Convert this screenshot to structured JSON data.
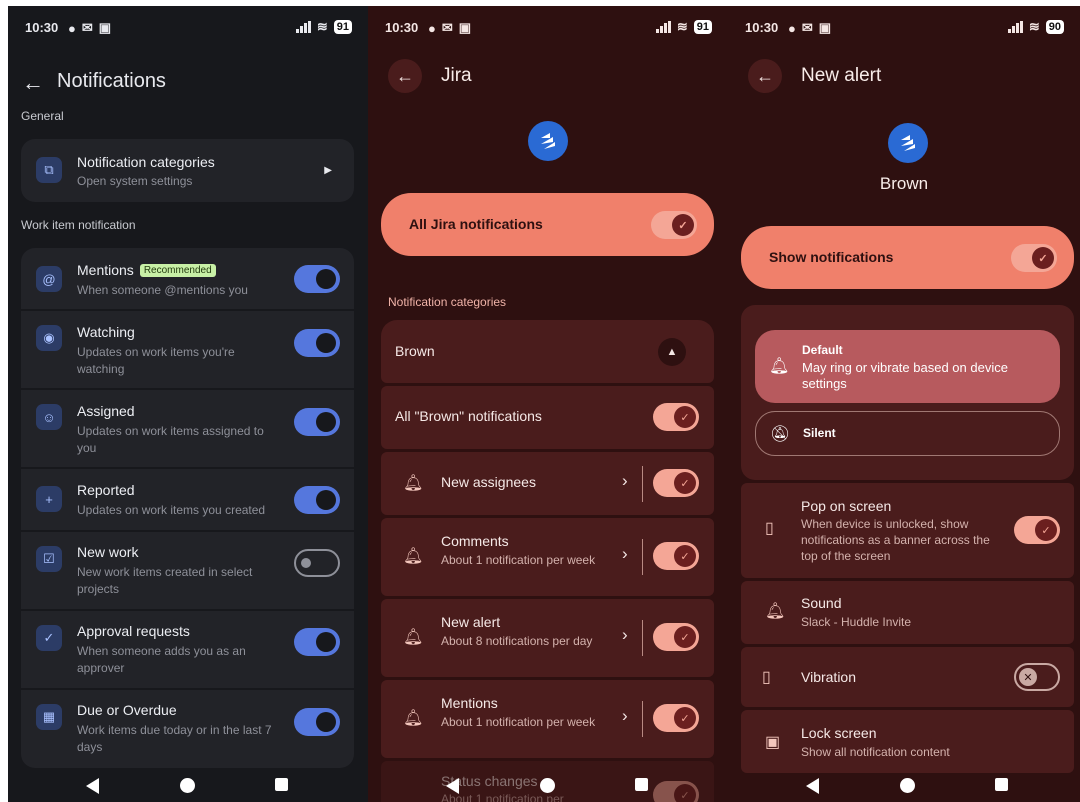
{
  "status": {
    "p1": {
      "time": "10:30",
      "battery": "91"
    },
    "p2": {
      "time": "10:30",
      "battery": "91"
    },
    "p3": {
      "time": "10:30",
      "battery": "90"
    }
  },
  "panel1": {
    "title": "Notifications",
    "general_label": "General",
    "notif_cat": {
      "title": "Notification categories",
      "sub": "Open system settings"
    },
    "work_label": "Work item notification",
    "items": [
      {
        "title": "Mentions",
        "badge": "Recommended",
        "sub": "When someone @mentions you",
        "on": true,
        "icon": "at-icon"
      },
      {
        "title": "Watching",
        "sub": "Updates on work items you're watching",
        "on": true,
        "icon": "eye-icon"
      },
      {
        "title": "Assigned",
        "sub": "Updates on work items assigned to you",
        "on": true,
        "icon": "assign-icon"
      },
      {
        "title": "Reported",
        "sub": "Updates on work items you created",
        "on": true,
        "icon": "person-add-icon"
      },
      {
        "title": "New work",
        "sub": "New work items created in select projects",
        "on": false,
        "icon": "checkbox-icon"
      },
      {
        "title": "Approval requests",
        "sub": "When someone adds you as an approver",
        "on": true,
        "icon": "check-circle-icon"
      },
      {
        "title": "Due or Overdue",
        "sub": "Work items due today or in the last 7 days",
        "on": true,
        "icon": "calendar-icon"
      }
    ]
  },
  "panel2": {
    "title": "Jira",
    "all_toggle": "All Jira notifications",
    "categories_label": "Notification categories",
    "group": "Brown",
    "group_all": "All \"Brown\" notifications",
    "channels": [
      {
        "title": "New assignees",
        "sub": ""
      },
      {
        "title": "Comments",
        "sub": "About 1 notification per week"
      },
      {
        "title": "New alert",
        "sub": "About 8 notifications per day"
      },
      {
        "title": "Mentions",
        "sub": "About 1 notification per week"
      },
      {
        "title": "Status changes",
        "sub": "About 1 notification per"
      }
    ]
  },
  "panel3": {
    "title": "New alert",
    "app_name": "Brown",
    "show_toggle": "Show notifications",
    "default_title": "Default",
    "default_sub": "May ring or vibrate based on device settings",
    "silent": "Silent",
    "pop_title": "Pop on screen",
    "pop_sub": "When device is unlocked, show notifications as a banner across the top of the screen",
    "sound_title": "Sound",
    "sound_sub": "Slack - Huddle Invite",
    "vibration": "Vibration",
    "lock_title": "Lock screen",
    "lock_sub": "Show all notification content"
  },
  "colors": {
    "accent_blue": "#5577dd",
    "salmon": "#f0806b",
    "dark_red": "#2e1010"
  }
}
